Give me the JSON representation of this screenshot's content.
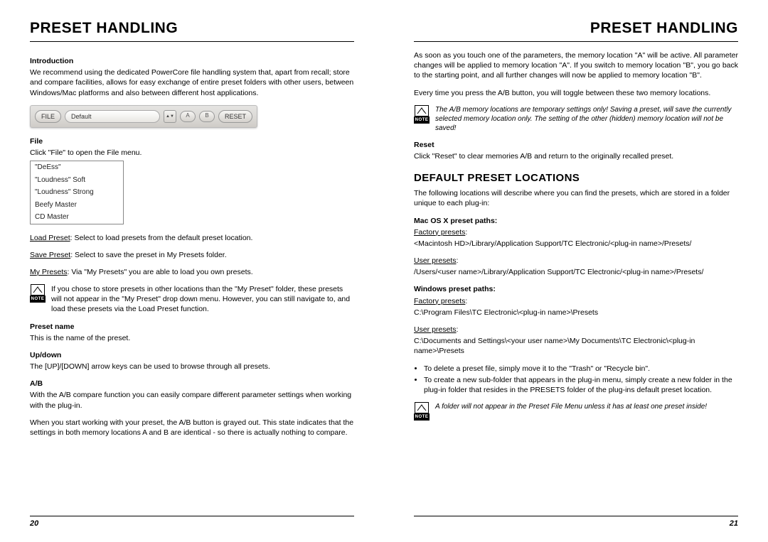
{
  "left": {
    "header": "PRESET HANDLING",
    "intro_h": "Introduction",
    "intro_p": "We recommend using the dedicated PowerCore file handling system that, apart from recall; store and compare facilities, allows for easy exchange of entire preset folders with other users, between Windows/Mac platforms and also between different host applications.",
    "toolbar": {
      "file": "FILE",
      "preset": "Default",
      "a": "A",
      "b": "B",
      "reset": "RESET"
    },
    "file_h": "File",
    "file_p": "Click \"File\" to open the File menu.",
    "menu_items": [
      "\"DeEss\"",
      "\"Loudness\" Soft",
      "\"Loudness\" Strong",
      "Beefy Master",
      "CD Master"
    ],
    "load_u": "Load Preset",
    "load_t": ": Select to load presets from the default preset location.",
    "save_u": "Save Preset",
    "save_t": ": Select to save the preset in My Presets folder.",
    "myp_u": "My Presets",
    "myp_t": ": Via \"My Presets\" you are able to load you own presets.",
    "note1": "If you chose to store presets in other locations than the \"My Preset\" folder, these presets will not appear in the \"My Preset\" drop down menu. However, you can still navigate to, and load these presets via the Load Preset function.",
    "pname_h": "Preset name",
    "pname_p": "This is the name of the preset.",
    "updown_h": "Up/down",
    "updown_p": "The [UP]/[DOWN] arrow keys can be used to browse through all presets.",
    "ab_h": "A/B",
    "ab_p1": "With the A/B compare function you can easily compare different parameter settings when working with the plug-in.",
    "ab_p2": "When you start working with your preset, the A/B button is grayed out. This state indicates that the settings in both memory locations A and B are identical - so there is actually nothing to compare.",
    "page_num": "20"
  },
  "right": {
    "header": "PRESET HANDLING",
    "top_p1": "As soon as you touch one of the parameters, the memory location \"A\" will be active. All parameter changes will be applied to memory location \"A\". If you switch to memory location \"B\", you go back to the starting point, and all further changes will now be applied to memory location \"B\".",
    "top_p2": "Every time you press the A/B button, you will toggle between these two memory locations.",
    "note2": "The A/B memory locations are temporary settings only! Saving a preset, will save the currently selected memory location only. The setting of the other (hidden) memory location will not be saved!",
    "reset_h": "Reset",
    "reset_p": "Click \"Reset\" to clear memories A/B and return to the originally recalled preset.",
    "dpl_h": "DEFAULT PRESET LOCATIONS",
    "dpl_p": "The following locations will describe where you can find the presets, which are stored in a folder unique to each plug-in:",
    "mac_h": "Mac OS X preset paths:",
    "mac_fac_u": "Factory presets",
    "mac_fac_t": ":",
    "mac_fac_path": "<Macintosh HD>/Library/Application Support/TC Electronic/<plug-in name>/Presets/",
    "mac_usr_u": "User presets",
    "mac_usr_t": ":",
    "mac_usr_path": "/Users/<user name>/Library/Application Support/TC Electronic/<plug-in name>/Presets/",
    "win_h": "Windows preset paths:",
    "win_fac_u": "Factory presets",
    "win_fac_t": ":",
    "win_fac_path": "C:\\Program Files\\TC Electronic\\<plug-in name>\\Presets",
    "win_usr_u": "User presets",
    "win_usr_t": ":",
    "win_usr_path": "C:\\Documents and Settings\\<your user name>\\My Documents\\TC Electronic\\<plug-in name>\\Presets",
    "bullet1": "To delete a preset file, simply move it to the \"Trash\" or \"Recycle bin\".",
    "bullet2": "To create a new sub-folder that appears in the plug-in menu, simply create a new folder in the plug-in folder that resides in the PRESETS folder of the plug-ins default preset location.",
    "note3": "A folder will not appear in the Preset File Menu unless it has at least one preset inside!",
    "page_num": "21"
  },
  "note_label": "NOTE"
}
